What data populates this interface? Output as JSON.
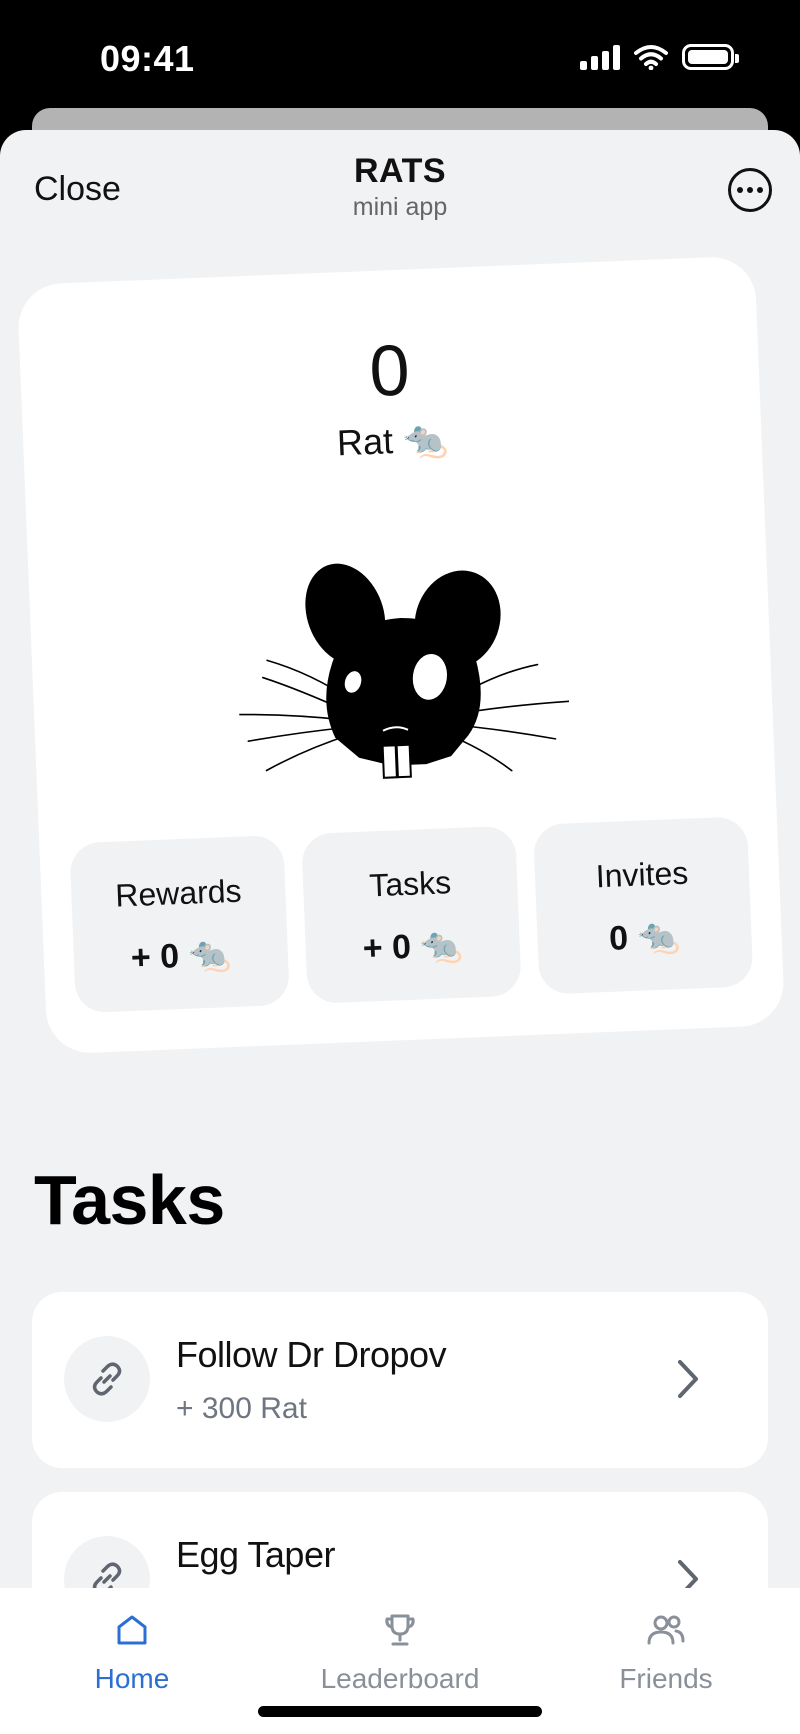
{
  "status_bar": {
    "time": "09:41"
  },
  "header": {
    "close_label": "Close",
    "title": "RATS",
    "subtitle": "mini app"
  },
  "balance": {
    "value": "0",
    "label": "Rat 🐀"
  },
  "stats": [
    {
      "label": "Rewards",
      "value": "+ 0 🐀"
    },
    {
      "label": "Tasks",
      "value": "+ 0 🐀"
    },
    {
      "label": "Invites",
      "value": "0 🐀"
    }
  ],
  "tasks": {
    "heading": "Tasks",
    "items": [
      {
        "title": "Follow Dr Dropov",
        "reward": "+ 300 Rat",
        "icon": "link-icon"
      },
      {
        "title": "Egg Taper",
        "reward": "",
        "icon": "link-icon"
      }
    ]
  },
  "tab_bar": {
    "tabs": [
      {
        "label": "Home",
        "icon": "home-icon",
        "active": true
      },
      {
        "label": "Leaderboard",
        "icon": "trophy-icon",
        "active": false
      },
      {
        "label": "Friends",
        "icon": "friends-icon",
        "active": false
      }
    ]
  },
  "colors": {
    "accent": "#2d6fd0",
    "background": "#f1f2f4",
    "muted": "#8a9099"
  }
}
